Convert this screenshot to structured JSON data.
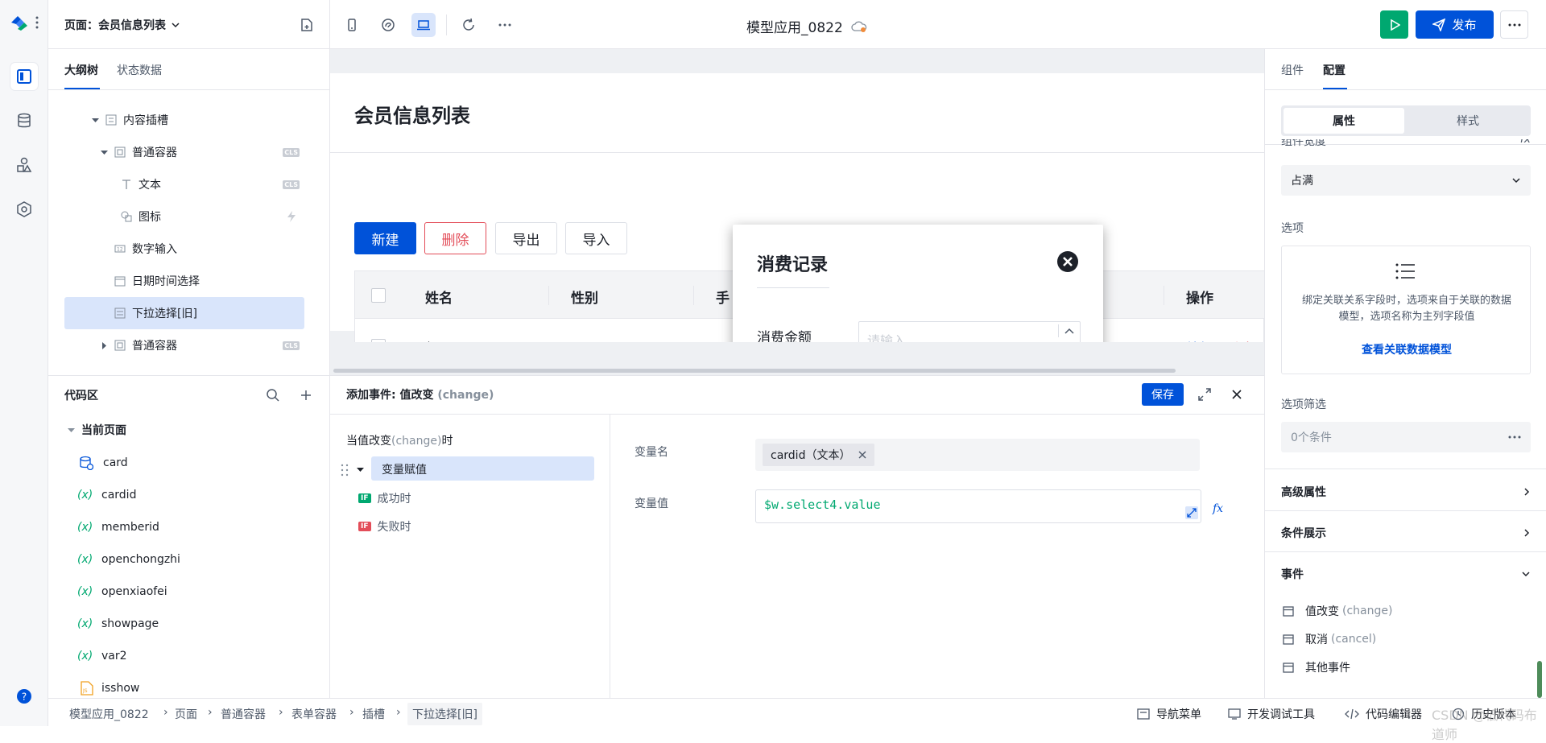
{
  "app": {
    "title": "模型应用_0822",
    "page_selector": "页面：会员信息列表",
    "publish_label": "发布"
  },
  "colors": {
    "primary": "#0052d9",
    "run_green": "#00a870",
    "danger": "#e34d59",
    "selected_bg": "#d9e5fb"
  },
  "left_panel": {
    "tabs": [
      "大纲树",
      "状态数据"
    ],
    "tree": [
      {
        "label": "内容插槽",
        "badge": ""
      },
      {
        "label": "普通容器",
        "badge": "CLS"
      },
      {
        "label": "文本",
        "badge": "CLS"
      },
      {
        "label": "图标",
        "badge": "bolt"
      },
      {
        "label": "数字输入",
        "badge": ""
      },
      {
        "label": "日期时间选择",
        "badge": ""
      },
      {
        "label": "下拉选择[旧]",
        "badge": ""
      },
      {
        "label": "普通容器",
        "badge": "CLS"
      }
    ],
    "code_area": {
      "title": "代码区",
      "group": "当前页面",
      "items": [
        {
          "kind": "data",
          "name": "card"
        },
        {
          "kind": "var",
          "name": "cardid"
        },
        {
          "kind": "var",
          "name": "memberid"
        },
        {
          "kind": "var",
          "name": "openchongzhi"
        },
        {
          "kind": "var",
          "name": "openxiaofei"
        },
        {
          "kind": "var",
          "name": "showpage"
        },
        {
          "kind": "var",
          "name": "var2"
        },
        {
          "kind": "js",
          "name": "isshow"
        }
      ],
      "var_prefix": "(x)"
    }
  },
  "canvas": {
    "page_title": "会员信息列表",
    "buttons": {
      "new": "新建",
      "delete": "删除",
      "export": "导出",
      "import": "导入"
    },
    "table": {
      "headers": [
        "姓名",
        "性别",
        "手",
        "操作"
      ],
      "row": {
        "name": "赵思",
        "gender": "-",
        "phone": "-",
        "edit": "编辑",
        "remove": "删除"
      }
    },
    "dialog": {
      "title": "消费记录",
      "field_label": "消费金额",
      "field_placeholder": "请输入"
    }
  },
  "event_panel": {
    "title": "添加事件: 值改变",
    "title_en": "(change)",
    "save": "保存",
    "trigger": "当值改变",
    "trigger_en": "(change)",
    "trigger_suffix": "时",
    "action": "变量赋值",
    "success": "成功时",
    "fail": "失败时",
    "if_badge": "IF",
    "var_name_label": "变量名",
    "var_name_tag": "cardid（文本）",
    "var_value_label": "变量值",
    "var_value": "$w.select4.value",
    "fx": "fx"
  },
  "right_panel": {
    "tabs": [
      "组件",
      "配置"
    ],
    "segments": [
      "属性",
      "样式"
    ],
    "clipped_label": "组件宽度",
    "width_value": "占满",
    "options_label": "选项",
    "options_desc": "绑定关联关系字段时，选项来自于关联的数据模型，选项名称为主列字段值",
    "options_link": "查看关联数据模型",
    "filter_label": "选项筛选",
    "filter_value": "0个条件",
    "sections": [
      "高级属性",
      "条件展示",
      "事件"
    ],
    "events": [
      {
        "label": "值改变",
        "en": "(change)"
      },
      {
        "label": "取消",
        "en": "(cancel)"
      },
      {
        "label": "其他事件",
        "en": ""
      }
    ]
  },
  "footer": {
    "breadcrumbs": [
      "模型应用_0822",
      "页面",
      "普通容器",
      "表单容器",
      "插槽",
      "下拉选择[旧]"
    ],
    "tools": [
      "导航菜单",
      "开发调试工具",
      "代码编辑器",
      "历史版本"
    ],
    "watermark": "CSDN @低代码布道师"
  }
}
